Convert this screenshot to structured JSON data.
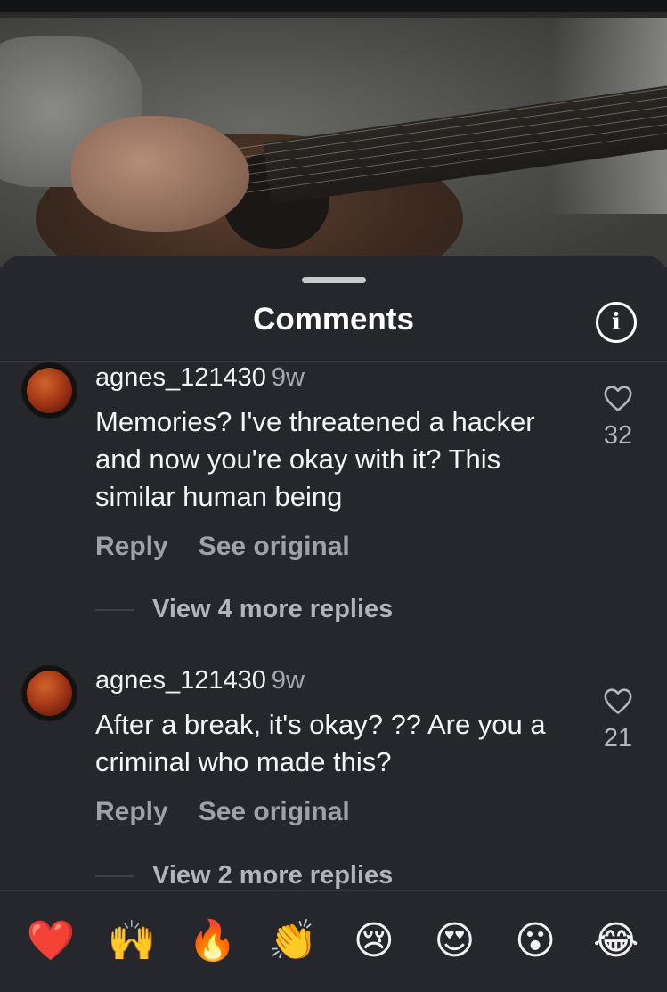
{
  "sheet": {
    "title": "Comments"
  },
  "comments": [
    {
      "username": "agnes_121430",
      "time": "9w",
      "text": "Memories? I've threatened a hacker and now you're okay with it? This similar human being",
      "reply_label": "Reply",
      "see_original_label": "See original",
      "likes": "32",
      "more_replies": "View 4 more replies"
    },
    {
      "username": "agnes_121430",
      "time": "9w",
      "text": "After a break, it's okay? ?? Are you a criminal who made this?",
      "reply_label": "Reply",
      "see_original_label": "See original",
      "likes": "21",
      "more_replies": "View 2 more replies"
    }
  ],
  "emoji_bar": [
    "❤️",
    "🙌",
    "🔥",
    "👏",
    "😢",
    "😍",
    "😮",
    "😂"
  ]
}
